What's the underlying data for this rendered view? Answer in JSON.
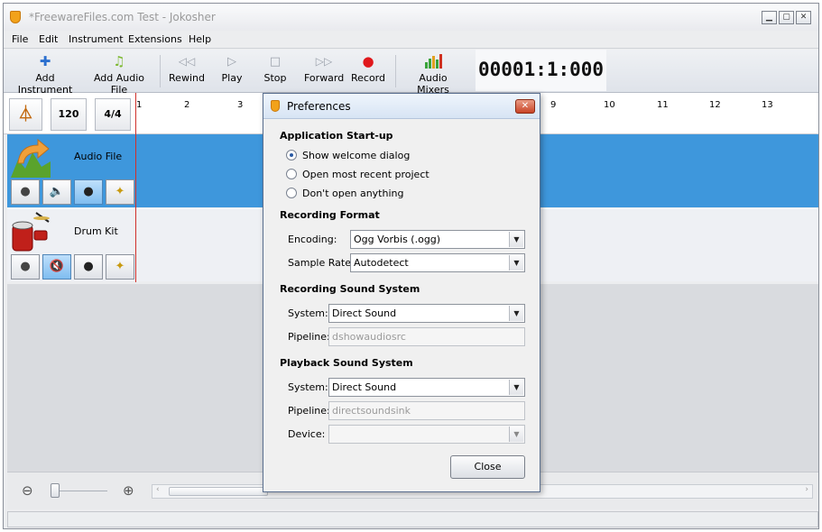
{
  "window": {
    "title": "*FreewareFiles.com Test - Jokosher"
  },
  "menu": [
    "File",
    "Edit",
    "Instrument",
    "Extensions",
    "Help"
  ],
  "toolbar": {
    "add_instrument": "Add Instrument",
    "add_audio_file": "Add Audio File",
    "rewind": "Rewind",
    "play": "Play",
    "stop": "Stop",
    "forward": "Forward",
    "record": "Record",
    "audio_mixers": "Audio Mixers",
    "counter": "00001:1:000"
  },
  "ruler": {
    "tempo": "120",
    "time_signature": "4/4",
    "bars": [
      "1",
      "2",
      "3",
      "9",
      "10",
      "11",
      "12",
      "13"
    ]
  },
  "tracks": [
    {
      "name": "Audio File",
      "selected": true
    },
    {
      "name": "Drum Kit",
      "selected": false
    }
  ],
  "preferences": {
    "title": "Preferences",
    "startup_heading": "Application Start-up",
    "startup_options": [
      "Show welcome dialog",
      "Open most recent project",
      "Don't open anything"
    ],
    "startup_selected": 0,
    "recording_format_heading": "Recording Format",
    "encoding_label": "Encoding:",
    "encoding_value": "Ogg Vorbis (.ogg)",
    "sample_rate_label": "Sample Rate:",
    "sample_rate_value": "Autodetect",
    "rec_sound_heading": "Recording Sound System",
    "rec_system_label": "System:",
    "rec_system_value": "Direct Sound",
    "rec_pipeline_label": "Pipeline:",
    "rec_pipeline_value": "dshowaudiosrc",
    "play_sound_heading": "Playback Sound System",
    "play_system_label": "System:",
    "play_system_value": "Direct Sound",
    "play_pipeline_label": "Pipeline:",
    "play_pipeline_value": "directsoundsink",
    "device_label": "Device:",
    "device_value": "",
    "close_label": "Close"
  }
}
